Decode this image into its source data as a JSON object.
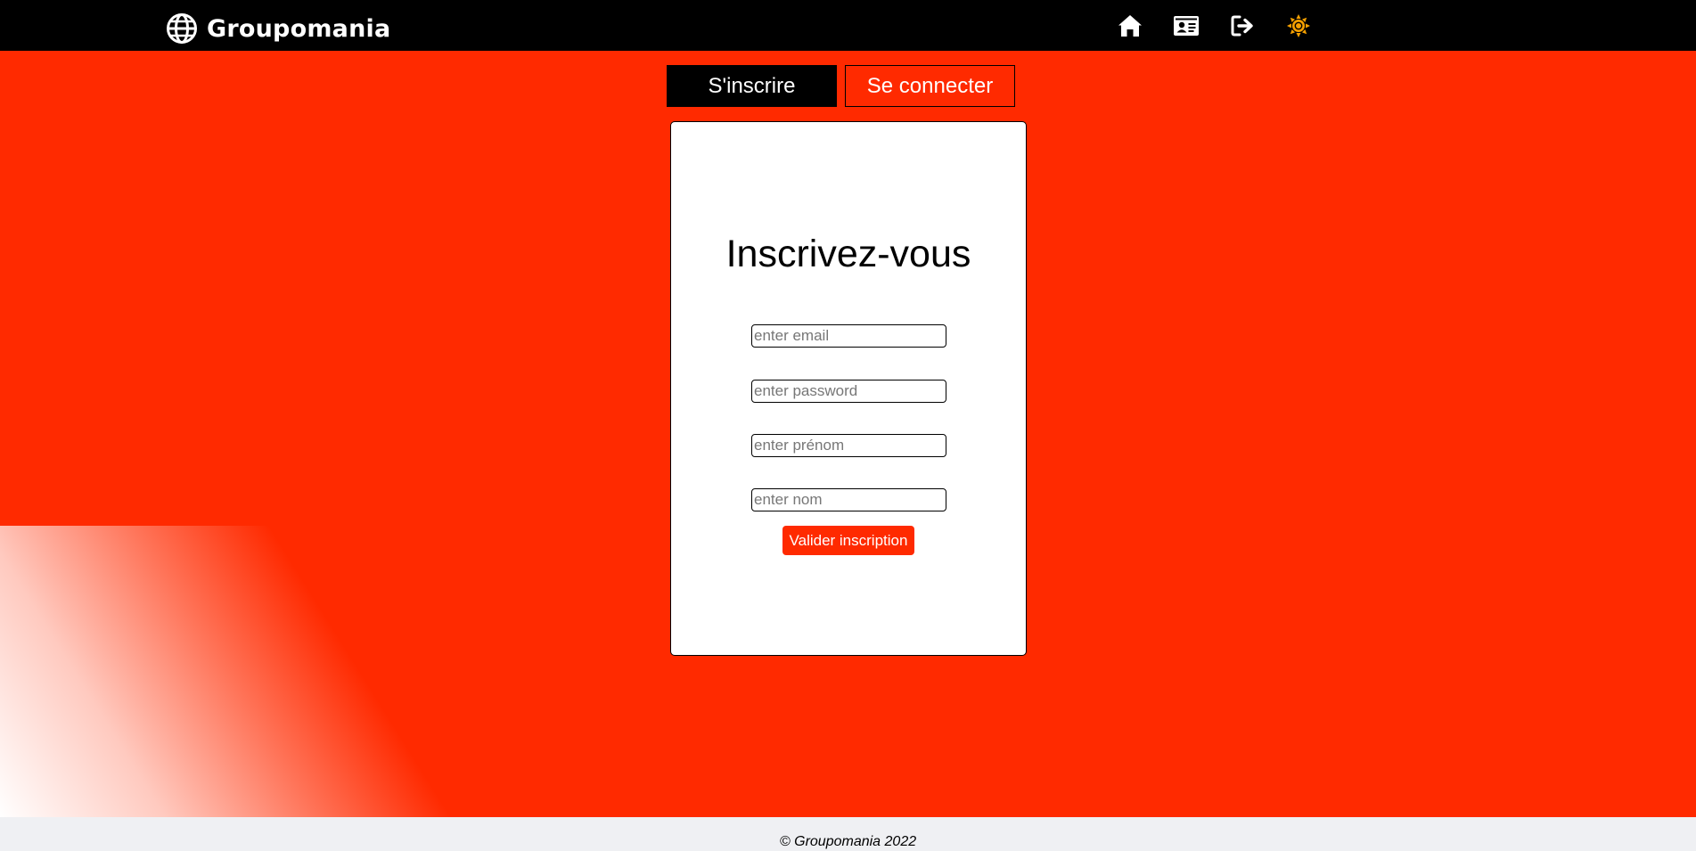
{
  "header": {
    "brand_name": "Groupomania",
    "icons": [
      "globe-icon",
      "home-icon",
      "profile-card-icon",
      "logout-icon",
      "sun-icon"
    ]
  },
  "tabs": [
    {
      "label": "S'inscrire",
      "active": true
    },
    {
      "label": "Se connecter",
      "active": false
    }
  ],
  "signup": {
    "title": "Inscrivez-vous",
    "email_placeholder": "enter email",
    "password_placeholder": "enter password",
    "firstname_placeholder": "enter prénom",
    "lastname_placeholder": "enter nom",
    "submit_label": "Valider inscription"
  },
  "footer": {
    "copyright": "© Groupomania 2022"
  },
  "colors": {
    "accent": "#ff2a00",
    "header_bg": "#000000",
    "card_bg": "#ffffff",
    "footer_bg": "#eff0f3",
    "theme_icon": "#f5a000"
  }
}
